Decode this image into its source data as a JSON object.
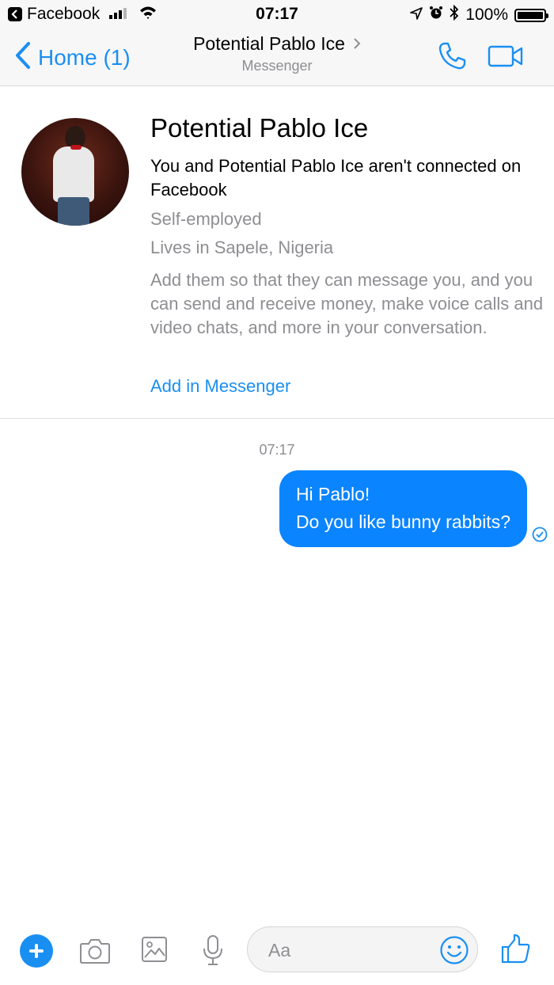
{
  "status_bar": {
    "back_app": "Facebook",
    "time": "07:17",
    "battery": "100%"
  },
  "nav": {
    "back_label": "Home (1)",
    "title": "Potential Pablo Ice",
    "subtitle": "Messenger"
  },
  "profile": {
    "name": "Potential Pablo Ice",
    "connection": "You and Potential Pablo Ice aren't connected on Facebook",
    "job": "Self-employed",
    "lives": "Lives in Sapele, Nigeria",
    "description": "Add them so that they can message you, and you can send and receive money, make voice calls and video chats, and more in your conversation.",
    "add_label": "Add in Messenger"
  },
  "conversation": {
    "timestamp": "07:17",
    "messages": [
      {
        "line1": "Hi Pablo!",
        "line2": "Do you like bunny rabbits?"
      }
    ]
  },
  "composer": {
    "placeholder": "Aa"
  },
  "colors": {
    "accent": "#1a8ff2",
    "bubble": "#0a84ff",
    "secondary_text": "#8e8e93"
  }
}
